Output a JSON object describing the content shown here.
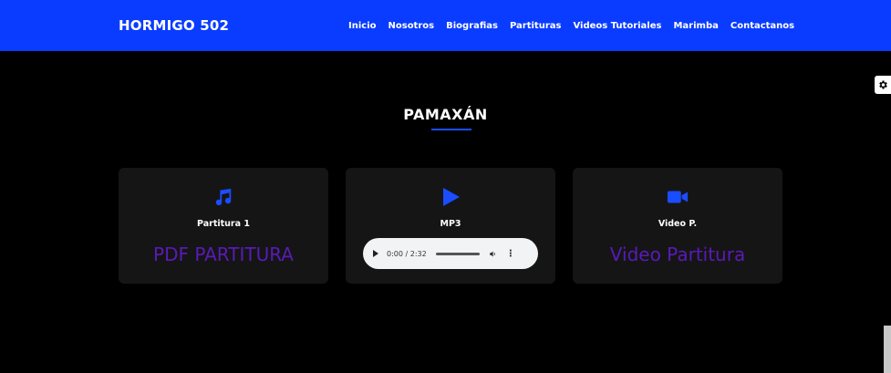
{
  "brand": "HORMIGO 502",
  "nav": [
    "Inicio",
    "Nosotros",
    "Biografias",
    "Partituras",
    "Videos Tutoriales",
    "Marimba",
    "Contactanos"
  ],
  "page_title": "PAMAXÁN",
  "cards": [
    {
      "title": "Partitura 1",
      "link": "PDF PARTITURA",
      "icon": "music-note-icon"
    },
    {
      "title": "MP3",
      "icon": "play-icon",
      "audio": {
        "time": "0:00 / 2:32"
      }
    },
    {
      "title": "Video P.",
      "link": "Video Partitura",
      "icon": "video-camera-icon"
    }
  ],
  "colors": {
    "nav_bg": "#0a3cff",
    "accent": "#1a4dff",
    "link": "#5a1ab8",
    "card_bg": "#151515"
  }
}
